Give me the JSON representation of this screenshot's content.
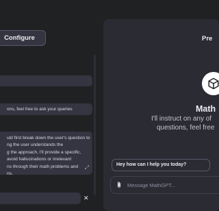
{
  "toolbar": {
    "configure_label": "Configure"
  },
  "config": {
    "description_value": "",
    "instructions_value": "ons, feel free to ask your queries",
    "instructions_expanded_lines": [
      "uld first break down the user's question to",
      "ng the user understands the",
      "g the approach, I'll provide a specific,",
      "avoid hallucinations or irrelevant",
      "ns through their math problems and",
      "ns."
    ],
    "last_field_value": ""
  },
  "preview": {
    "title": "Pre",
    "gpt_name": "Math",
    "description_line1": "I'll instruct on any of",
    "description_line2": "questions, feel free",
    "starter": "Hey how can I help you today?",
    "message_placeholder": "Message MathGPT..."
  },
  "icons": {
    "expand": "expand-icon",
    "close": "close-icon",
    "logo": "cube-icon",
    "attach": "paperclip-icon"
  }
}
